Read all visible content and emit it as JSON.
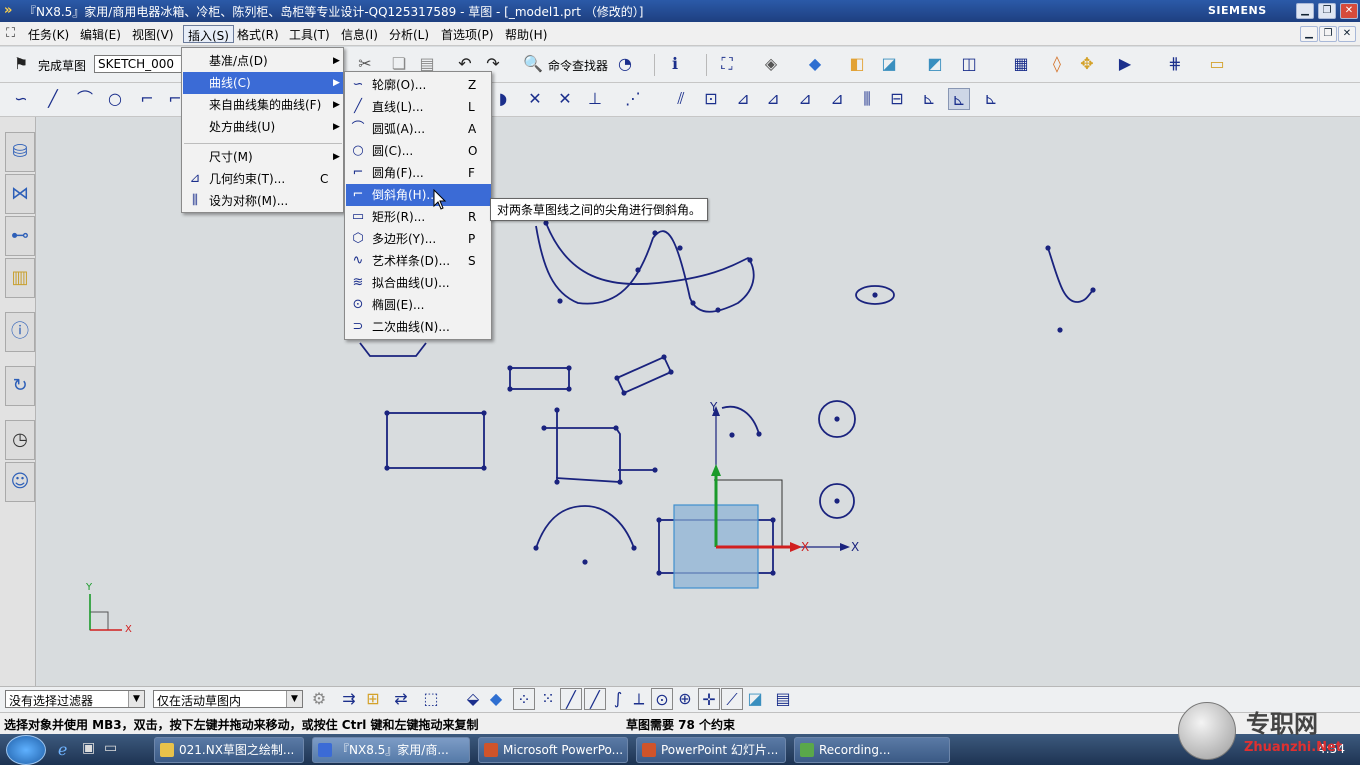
{
  "title_bar": {
    "title": "『NX8.5』家用/商用电器冰箱、冷柜、陈列柜、岛柜等专业设计-QQ125317589 - 草图 - [_model1.prt （修改的）]",
    "brand": "SIEMENS"
  },
  "menubar": {
    "items": [
      "任务(K)",
      "编辑(E)",
      "视图(V)",
      "插入(S)",
      "格式(R)",
      "工具(T)",
      "信息(I)",
      "分析(L)",
      "首选项(P)",
      "帮助(H)"
    ]
  },
  "toolbar": {
    "finish_sketch": "完成草图",
    "sketch_name": "SKETCH_000",
    "command_finder": "命令查找器"
  },
  "insert_menu": {
    "items": [
      {
        "label": "基准/点(D)",
        "shortcut": "",
        "submenu": true
      },
      {
        "label": "曲线(C)",
        "shortcut": "",
        "submenu": true
      },
      {
        "label": "来自曲线集的曲线(F)",
        "shortcut": "",
        "submenu": true
      },
      {
        "label": "处方曲线(U)",
        "shortcut": "",
        "submenu": true
      },
      {
        "label": "尺寸(M)",
        "shortcut": "",
        "submenu": true
      },
      {
        "label": "几何约束(T)...",
        "shortcut": "C",
        "submenu": false
      },
      {
        "label": "设为对称(M)...",
        "shortcut": "",
        "submenu": false
      }
    ]
  },
  "curve_menu": {
    "items": [
      {
        "label": "轮廓(O)...",
        "shortcut": "Z",
        "icon": "profile-icon"
      },
      {
        "label": "直线(L)...",
        "shortcut": "L",
        "icon": "line-icon"
      },
      {
        "label": "圆弧(A)...",
        "shortcut": "A",
        "icon": "arc-icon"
      },
      {
        "label": "圆(C)...",
        "shortcut": "O",
        "icon": "circle-icon"
      },
      {
        "label": "圆角(F)...",
        "shortcut": "F",
        "icon": "fillet-icon"
      },
      {
        "label": "倒斜角(H)...",
        "shortcut": "",
        "icon": "chamfer-icon"
      },
      {
        "label": "矩形(R)...",
        "shortcut": "R",
        "icon": "rectangle-icon"
      },
      {
        "label": "多边形(Y)...",
        "shortcut": "P",
        "icon": "polygon-icon"
      },
      {
        "label": "艺术样条(D)...",
        "shortcut": "S",
        "icon": "spline-icon"
      },
      {
        "label": "拟合曲线(U)...",
        "shortcut": "",
        "icon": "fit-curve-icon"
      },
      {
        "label": "椭圆(E)...",
        "shortcut": "",
        "icon": "ellipse-icon"
      },
      {
        "label": "二次曲线(N)...",
        "shortcut": "",
        "icon": "conic-icon"
      }
    ],
    "highlighted_index": 5
  },
  "tooltip": "对两条草图线之间的尖角进行倒斜角。",
  "canvas": {
    "axis_x": "X",
    "axis_y": "Y",
    "triad_x": "X",
    "triad_y": "Y",
    "handle_x": "X"
  },
  "selection_bar": {
    "filter": "没有选择过滤器",
    "scope": "仅在活动草图内"
  },
  "status": {
    "prompt": "选择对象并使用 MB3，双击，按下左键并拖动来移动，或按住 Ctrl 键和左键拖动来复制",
    "constraints": "草图需要 78 个约束"
  },
  "taskbar": {
    "items": [
      "021.NX草图之绘制...",
      "『NX8.5』家用/商...",
      "Microsoft PowerPo...",
      "PowerPoint 幻灯片...",
      "Recording..."
    ],
    "time": "4:54"
  },
  "watermark": {
    "text": "专职网",
    "url": "Zhuanzhi.Net"
  },
  "colors": {
    "accent": "#3b6bd6",
    "sketch_curve": "#1a237e",
    "title_bar": "#1e3f80"
  }
}
